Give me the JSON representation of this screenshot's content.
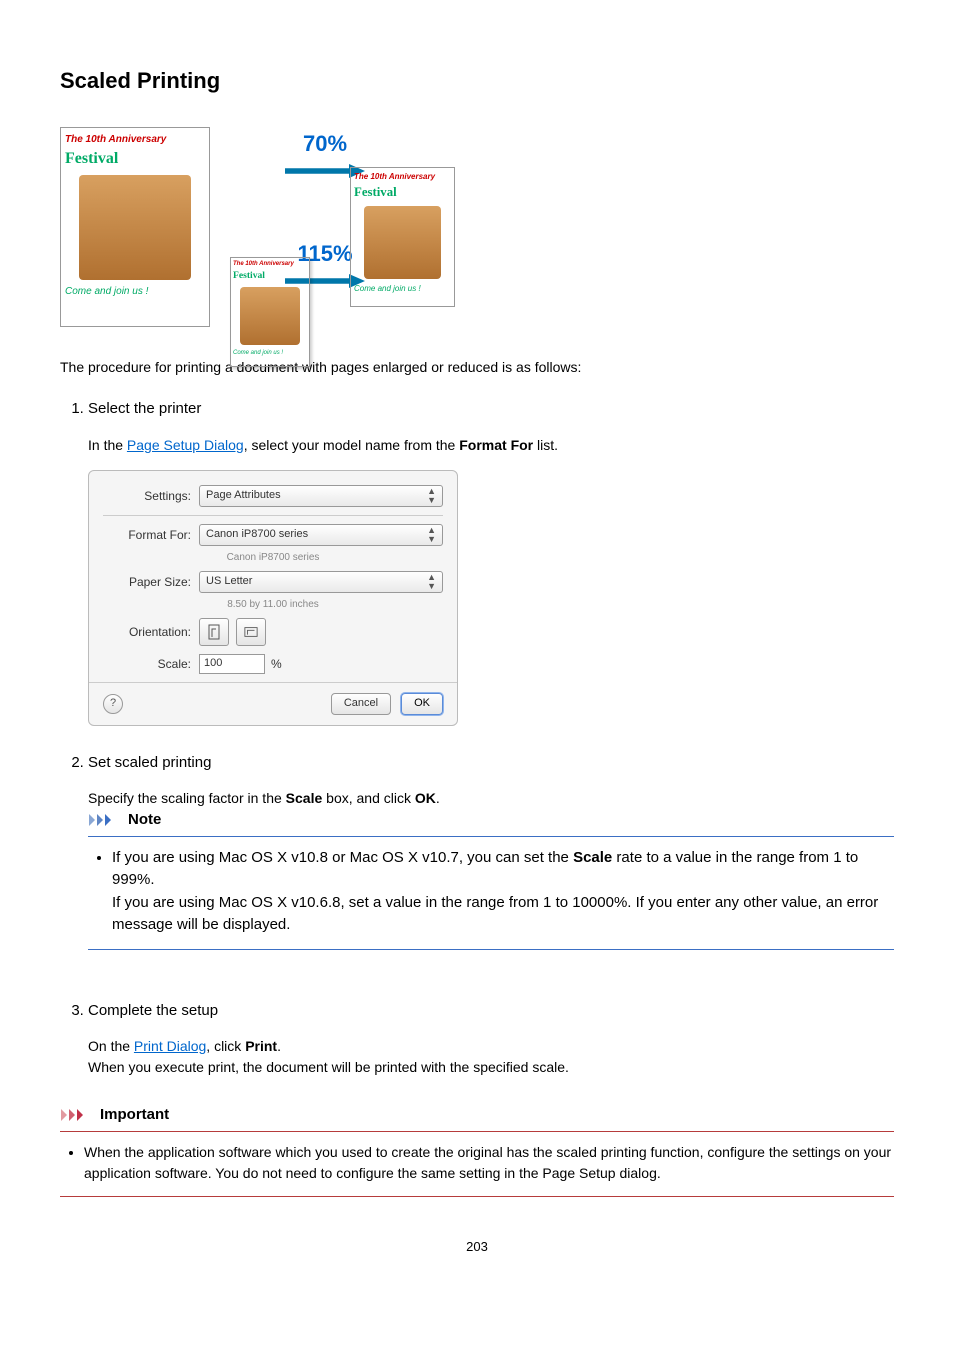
{
  "page_title": "Scaled Printing",
  "illustration": {
    "doc_red_title": "The 10th Anniversary",
    "doc_green_title": "Festival",
    "doc_join": "Come and join us !",
    "pct_70": "70%",
    "pct_115": "115%"
  },
  "intro_text": "The procedure for printing a document with pages enlarged or reduced is as follows:",
  "steps": [
    {
      "title": "Select the printer",
      "desc_pre": "In the ",
      "desc_link": "Page Setup Dialog",
      "desc_mid": ", select your model name from the ",
      "desc_bold": "Format For",
      "desc_post": " list."
    },
    {
      "title": "Set scaled printing",
      "desc_pre": "Specify the scaling factor in the ",
      "desc_bold": "Scale",
      "desc_mid": " box, and click ",
      "desc_bold2": "OK",
      "desc_post": "."
    },
    {
      "title": "Complete the setup",
      "desc_pre": "On the ",
      "desc_link": "Print Dialog",
      "desc_mid": ", click ",
      "desc_bold": "Print",
      "desc_post": ".",
      "desc_line2": "When you execute print, the document will be printed with the specified scale."
    }
  ],
  "dialog": {
    "settings_label": "Settings:",
    "settings_value": "Page Attributes",
    "format_for_label": "Format For:",
    "format_for_value": "Canon iP8700 series",
    "format_for_hint": "Canon iP8700 series",
    "paper_size_label": "Paper Size:",
    "paper_size_value": "US Letter",
    "paper_size_hint": "8.50 by 11.00 inches",
    "orientation_label": "Orientation:",
    "scale_label": "Scale:",
    "scale_value": "100",
    "scale_unit": "%",
    "help": "?",
    "cancel": "Cancel",
    "ok": "OK"
  },
  "note": {
    "heading": "Note",
    "bullet_pre": "If you are using Mac OS X v10.8 or Mac OS X v10.7, you can set the ",
    "bullet_bold": "Scale",
    "bullet_post": " rate to a value in the range from 1 to 999%.",
    "line2": "If you are using Mac OS X v10.6.8, set a value in the range from 1 to 10000%. If you enter any other value, an error message will be displayed."
  },
  "important": {
    "heading": "Important",
    "bullet": "When the application software which you used to create the original has the scaled printing function, configure the settings on your application software. You do not need to configure the same setting in the Page Setup dialog."
  },
  "page_number": "203"
}
